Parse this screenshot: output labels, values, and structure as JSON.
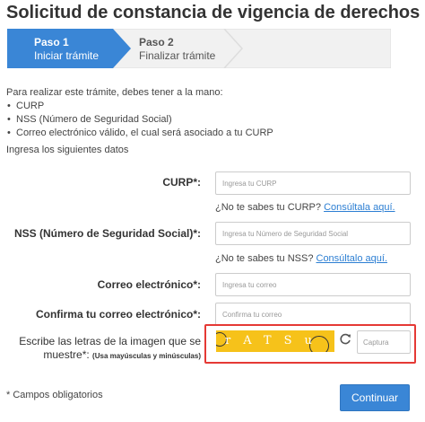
{
  "page": {
    "title": "Solicitud de constancia de vigencia de derechos"
  },
  "stepper": {
    "steps": [
      {
        "number": "Paso 1",
        "label": "Iniciar trámite",
        "state": "active"
      },
      {
        "number": "Paso 2",
        "label": "Finalizar trámite",
        "state": "inactive"
      }
    ]
  },
  "intro": {
    "text": "Para realizar este trámite, debes tener a la mano:",
    "items": [
      "CURP",
      "NSS (Número de Seguridad Social)",
      "Correo electrónico válido, el cual será asociado a tu CURP"
    ]
  },
  "form": {
    "subtitle": "Ingresa los siguientes datos",
    "curp": {
      "label": "CURP*:",
      "placeholder": "Ingresa tu CURP",
      "help_text": "¿No te sabes tu CURP? ",
      "help_link": "Consúltala aquí."
    },
    "nss": {
      "label": "NSS (Número de Seguridad Social)*:",
      "placeholder": "Ingresa tu Número de Seguridad Social",
      "help_text": "¿No te sabes tu NSS? ",
      "help_link": "Consúltalo aquí."
    },
    "email": {
      "label": "Correo electrónico*:",
      "placeholder": "Ingresa tu correo"
    },
    "email_confirm": {
      "label": "Confirma tu correo electrónico*:",
      "placeholder": "Confirma tu correo"
    },
    "captcha": {
      "label_line1": "Escribe las letras de la imagen que se",
      "label_line2": "muestre*:",
      "label_note": "(Usa mayúsculas y minúsculas)",
      "image_text": "rATSu",
      "placeholder": "Captura",
      "refresh_icon": "refresh-icon"
    }
  },
  "footer": {
    "required_note": "* Campos obligatorios",
    "submit_label": "Continuar"
  },
  "colors": {
    "accent": "#3a86d6",
    "error_border": "#e53935",
    "captcha_bg": "#f6c21a",
    "link": "#2d7fd3"
  }
}
